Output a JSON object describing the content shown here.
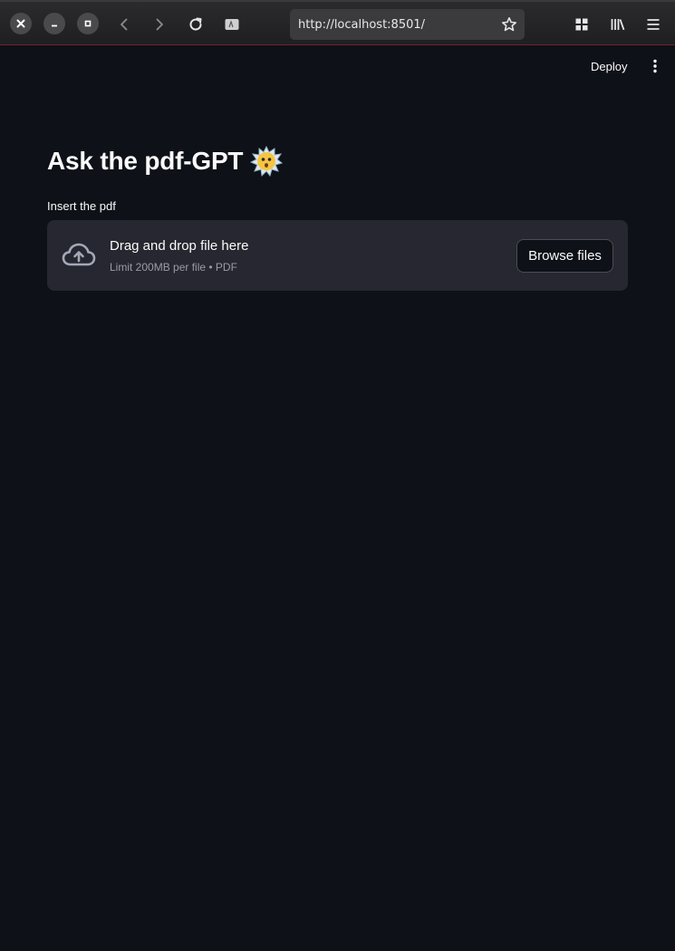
{
  "browser": {
    "url": "http://localhost:8501/"
  },
  "header": {
    "deploy_label": "Deploy"
  },
  "main": {
    "title": "Ask the pdf-GPT",
    "uploader": {
      "label": "Insert the pdf",
      "drop_text": "Drag and drop file here",
      "limit_text": "Limit 200MB per file • PDF",
      "browse_label": "Browse files"
    }
  },
  "colors": {
    "background": "#0e1117",
    "dropzone": "#262730",
    "text": "#fafafa",
    "muted": "#9a9ca3"
  },
  "icons": [
    "close-icon",
    "minimize-icon",
    "maximize-icon",
    "back-icon",
    "forward-icon",
    "reload-icon",
    "page-info-icon",
    "bookmark-star-icon",
    "extensions-icon",
    "library-icon",
    "menu-icon",
    "more-vertical-icon",
    "cloud-upload-icon",
    "dizzy-face-emoji-icon"
  ]
}
